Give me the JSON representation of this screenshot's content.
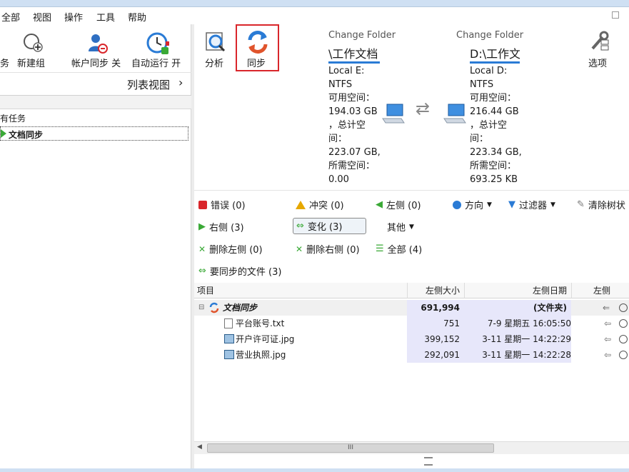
{
  "menu": {
    "items": [
      "全部",
      "视图",
      "操作",
      "工具",
      "帮助"
    ]
  },
  "left_toolbar": {
    "task_label": "务",
    "new_group": "新建组",
    "account_sync": "帐户同步 关",
    "auto_run": "自动运行 开"
  },
  "listview": {
    "label": "列表视图",
    "chevron": "›"
  },
  "tree": {
    "all_tasks": "有任务",
    "selected_task": "文档同步"
  },
  "toolbar": {
    "analyze": "分析",
    "sync": "同步",
    "options": "选项",
    "swap_arrows": "⇄"
  },
  "left_folder": {
    "title": "Change Folder",
    "path": "\\工作文档",
    "info": "Local E:\nNTFS\n可用空间：\n194.03 GB\n，总计空\n间：\n223.07 GB,\n所需空间：\n0.00"
  },
  "right_folder": {
    "title": "Change Folder",
    "path": "D:\\工作文",
    "info": "Local D:\nNTFS\n可用空间：\n216.44 GB\n，总计空\n间：\n223.34 GB,\n所需空间：\n693.25 KB"
  },
  "filters": {
    "errors": "错误 (0)",
    "conflicts": "冲突 (0)",
    "left": "左侧 (0)",
    "direction": "方向",
    "filter": "过滤器",
    "clear_tree": "清除树状",
    "right": "右侧 (3)",
    "changes": "变化 (3)",
    "other": "其他",
    "delete_left": "删除左侧 (0)",
    "delete_right": "删除右侧 (0)",
    "all": "全部 (4)",
    "to_sync": "要同步的文件 (3)"
  },
  "table": {
    "headers": {
      "item": "项目",
      "left_size": "左侧大小",
      "left_date": "左侧日期",
      "left": "左侧"
    },
    "group": {
      "name": "文档同步",
      "size": "691,994",
      "date": "(文件夹)"
    },
    "rows": [
      {
        "name": "平台账号.txt",
        "size": "751",
        "date": "7-9 星期五 16:05:50"
      },
      {
        "name": "开户许可证.jpg",
        "size": "399,152",
        "date": "3-11 星期一 14:22:29"
      },
      {
        "name": "营业执照.jpg",
        "size": "292,091",
        "date": "3-11 星期一 14:22:28"
      }
    ]
  },
  "scrollbar": {
    "grip": "III"
  },
  "colors": {
    "accent_blue": "#2a7bd5",
    "highlight_red": "#d9262b",
    "green": "#3aa936",
    "date_column": "#e7e7fa"
  }
}
